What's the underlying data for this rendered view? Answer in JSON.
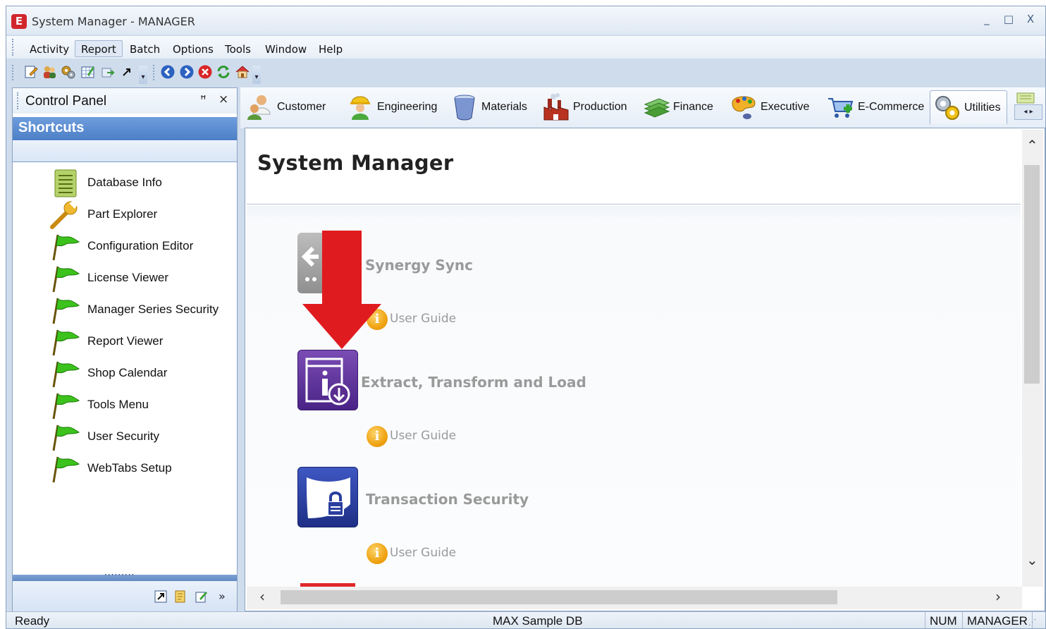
{
  "window": {
    "title": "System Manager - MANAGER",
    "logo_letter": "E",
    "controls": [
      "_",
      "□",
      "X"
    ]
  },
  "menu": {
    "items": [
      "Activity",
      "Report",
      "Batch",
      "Options",
      "Tools",
      "Window",
      "Help"
    ],
    "active": "Report"
  },
  "toolbar": {
    "icons": [
      "new-record-icon",
      "users-icon",
      "gears-icon",
      "edit-grid-icon",
      "export-icon",
      "shortcut-arrow-icon",
      "back-icon",
      "forward-icon",
      "stop-icon",
      "refresh-icon",
      "home-icon"
    ]
  },
  "control_panel": {
    "title": "Control Panel",
    "pin": "ꟸ",
    "close": "×",
    "section": "Shortcuts",
    "splitter_dots": "·········",
    "items": [
      {
        "label": "Database Info",
        "icon": "list-document-icon"
      },
      {
        "label": "Part Explorer",
        "icon": "wrench-icon"
      },
      {
        "label": "Configuration Editor",
        "icon": "green-flag-icon"
      },
      {
        "label": "License Viewer",
        "icon": "green-flag-icon"
      },
      {
        "label": "Manager Series Security",
        "icon": "green-flag-icon"
      },
      {
        "label": "Report Viewer",
        "icon": "green-flag-icon"
      },
      {
        "label": "Shop Calendar",
        "icon": "green-flag-icon"
      },
      {
        "label": "Tools Menu",
        "icon": "green-flag-icon"
      },
      {
        "label": "User Security",
        "icon": "green-flag-icon"
      },
      {
        "label": "WebTabs Setup",
        "icon": "green-flag-icon"
      }
    ],
    "footer_overflow": "»"
  },
  "tabs": {
    "items": [
      "Customer",
      "Engineering",
      "Materials",
      "Production",
      "Finance",
      "Executive",
      "E-Commerce",
      "Utilities"
    ],
    "active": "Utilities",
    "scroll_left": "◂",
    "scroll_right": "▸"
  },
  "content": {
    "title": "System Manager",
    "modules": [
      {
        "title": "Synergy Sync",
        "guide": "User Guide",
        "icon": "synergy-sync-icon",
        "color": "#9a9a9a"
      },
      {
        "title": "Extract, Transform and Load",
        "guide": "User Guide",
        "icon": "etl-icon",
        "color": "#5a2d91"
      },
      {
        "title": "Transaction Security",
        "guide": "User Guide",
        "icon": "transaction-security-icon",
        "color": "#2b3f9e"
      }
    ],
    "guide_glyph": "i",
    "annotation_color": "#e01b1f"
  },
  "scroll": {
    "up": "⌃",
    "down": "⌄",
    "left": "‹",
    "right": "›"
  },
  "status": {
    "left": "Ready",
    "database": "MAX Sample DB",
    "num": "NUM",
    "user": "MANAGER"
  }
}
